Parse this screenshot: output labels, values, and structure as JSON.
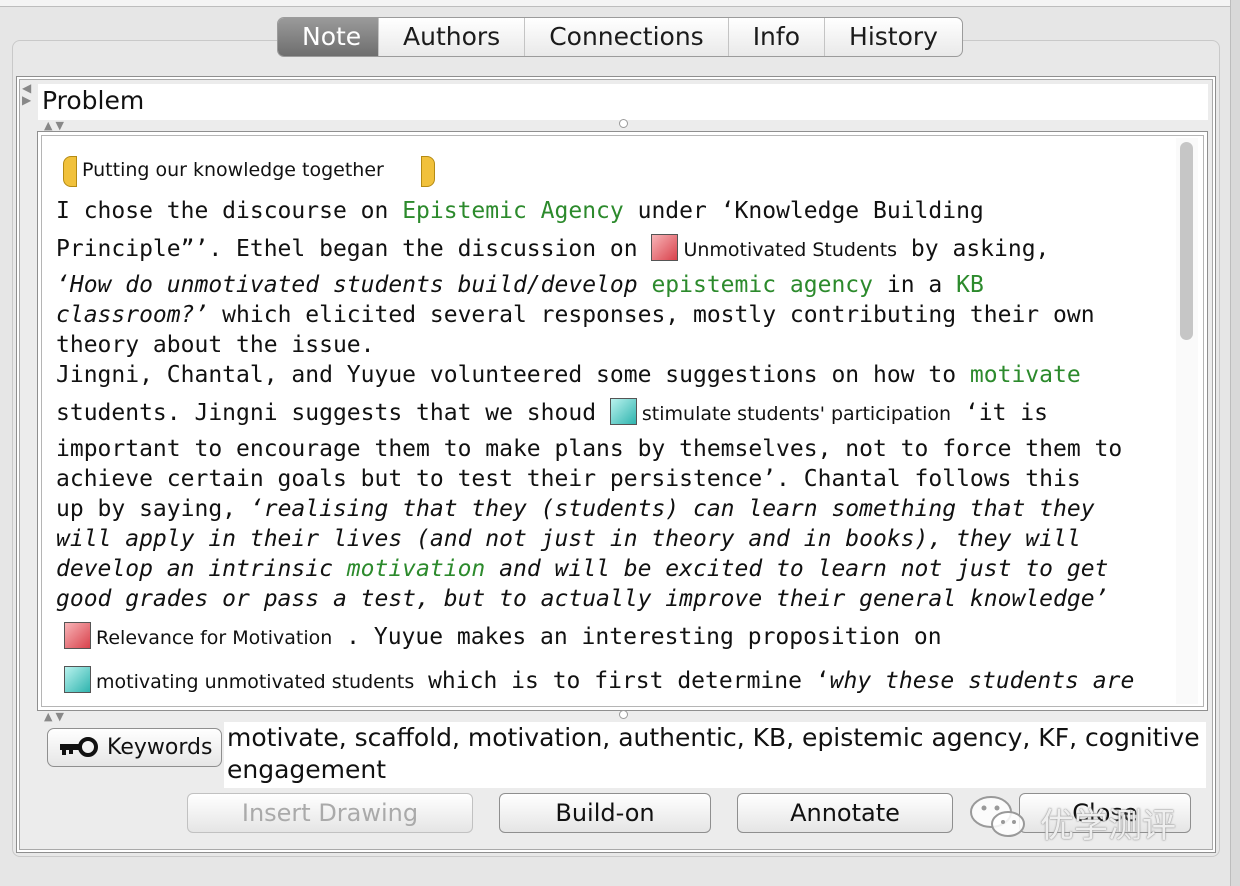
{
  "tabs": [
    {
      "label": "Note",
      "active": true
    },
    {
      "label": "Authors",
      "active": false
    },
    {
      "label": "Connections",
      "active": false
    },
    {
      "label": "Info",
      "active": false
    },
    {
      "label": "History",
      "active": false
    }
  ],
  "problem": {
    "label": "Problem",
    "value": ""
  },
  "note": {
    "reference_title": "Putting our knowledge together",
    "lines": {
      "l1a": "I chose the discourse on ",
      "l1b": "Epistemic Agency",
      "l1c": " under ‘Knowledge Building",
      "l2a": "Principle”’.  Ethel began the discussion on ",
      "l2scaffold": "Unmotivated Students",
      "l2c": "  by asking,",
      "l3a": "‘How do unmotivated students build/develop ",
      "l3b": "epistemic agency",
      "l3c": " in a ",
      "l3d": "KB",
      "l4a": "classroom?’",
      "l4b": "  which elicited several responses, mostly contributing their own",
      "l5": "theory about the issue.",
      "l6a": "Jingni, Chantal, and Yuyue volunteered some suggestions on how to ",
      "l6b": "motivate",
      "l7a": "students.   Jingni suggests that we shoud ",
      "l7scaffold": "stimulate students' participation",
      "l7c": " ‘it is",
      "l8": "important to encourage them to make plans by themselves, not to force them to",
      "l9": "achieve certain goals but to test their persistence’.  Chantal follows this",
      "l10a": "up by saying, ",
      "l10b": "‘realising that they (students) can learn something that they",
      "l11": "will apply in their lives (and not just in theory and in books), they will",
      "l12a": "develop an intrinsic ",
      "l12b": "motivation",
      "l12c": " and will be excited to learn not just to get",
      "l13": "good grades or pass a test, but to actually improve their general knowledge’",
      "l14scaffold": "Relevance for Motivation",
      "l14b": " .  Yuyue makes an interesting proposition on",
      "l15scaffold": "motivating unmotivated students",
      "l15b": " which is to first determine ‘",
      "l15c": "why these students are"
    }
  },
  "keywords": {
    "button_label": "Keywords",
    "value_line1": "motivate, scaffold, motivation, authentic, KB, epistemic agency, KF, cognitive",
    "value_line2": "engagement"
  },
  "buttons": {
    "insert_drawing": "Insert Drawing",
    "build_on": "Build-on",
    "annotate": "Annotate",
    "close": "Close"
  },
  "watermark": {
    "text": "优学测评"
  },
  "colors": {
    "green_link": "#2c8a2c",
    "tab_active": "#7d7d7d",
    "scaffold_red": "#d9424c",
    "scaffold_cyan": "#2fb4ae",
    "reference_yellow": "#f1c13b"
  },
  "icons": [
    "key-icon",
    "scaffold-red-icon",
    "scaffold-cyan-icon",
    "wechat-icon"
  ]
}
